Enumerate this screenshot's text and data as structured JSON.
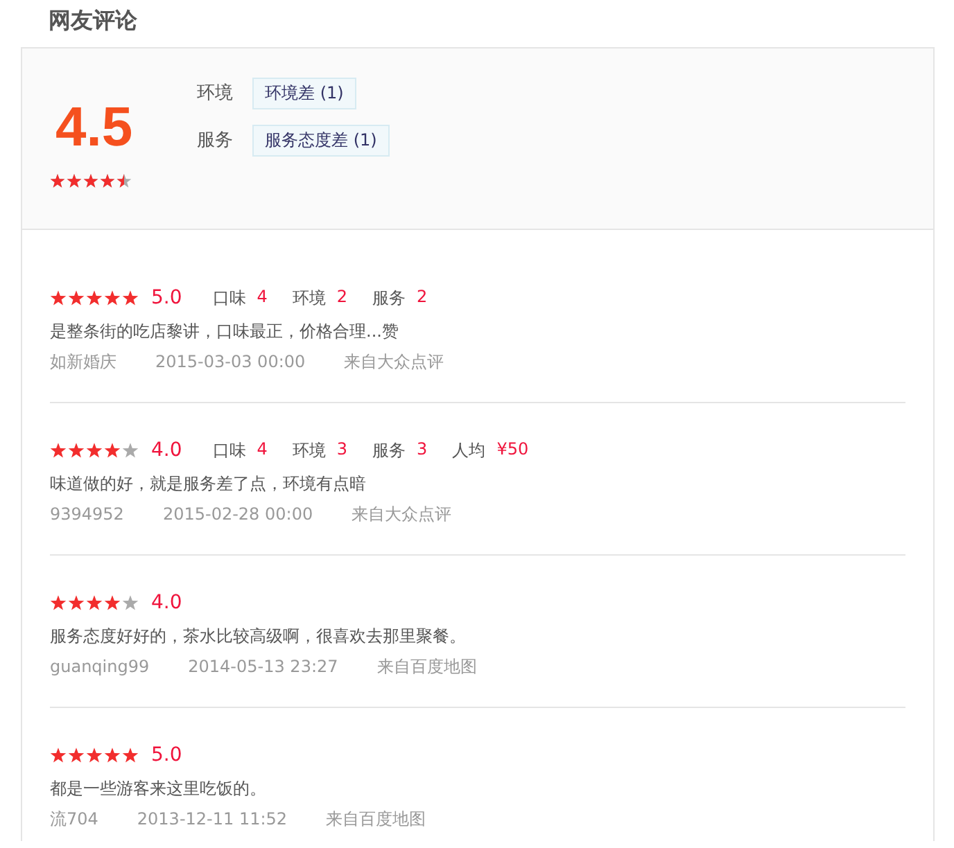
{
  "title": "网友评论",
  "summary": {
    "score": "4.5",
    "stars": 4.5,
    "tags": [
      {
        "category": "环境",
        "label": "环境差 (1)"
      },
      {
        "category": "服务",
        "label": "服务态度差 (1)"
      }
    ]
  },
  "reviews": [
    {
      "stars": 5,
      "rating": "5.0",
      "scores": [
        {
          "label": "口味",
          "value": "4"
        },
        {
          "label": "环境",
          "value": "2"
        },
        {
          "label": "服务",
          "value": "2"
        }
      ],
      "text": "是整条街的吃店黎讲，口味最正，价格合理...赞",
      "user": "如新婚庆",
      "time": "2015-03-03 00:00",
      "source": "来自大众点评"
    },
    {
      "stars": 4,
      "rating": "4.0",
      "scores": [
        {
          "label": "口味",
          "value": "4"
        },
        {
          "label": "环境",
          "value": "3"
        },
        {
          "label": "服务",
          "value": "3"
        },
        {
          "label": "人均",
          "value": "¥50"
        }
      ],
      "text": "味道做的好，就是服务差了点，环境有点暗",
      "user": "9394952",
      "time": "2015-02-28 00:00",
      "source": "来自大众点评"
    },
    {
      "stars": 4,
      "rating": "4.0",
      "text": "服务态度好好的，茶水比较高级啊，很喜欢去那里聚餐。",
      "user": "guanqing99",
      "time": "2014-05-13 23:27",
      "source": "来自百度地图"
    },
    {
      "stars": 5,
      "rating": "5.0",
      "text": "都是一些游客来这里吃饭的。",
      "user": "流704",
      "time": "2013-12-11 11:52",
      "source": "来自百度地图"
    }
  ]
}
